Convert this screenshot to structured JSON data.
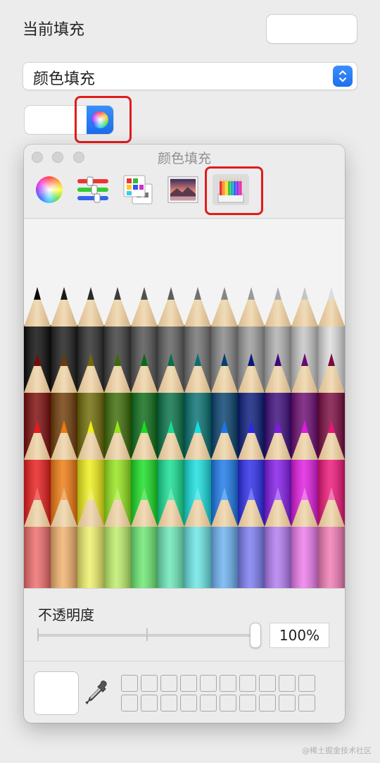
{
  "inspector": {
    "current_fill_label": "当前填充",
    "fill_type_value": "颜色填充"
  },
  "color_panel": {
    "title": "颜色填充",
    "toolbar_tabs": [
      {
        "icon": "color-wheel-icon"
      },
      {
        "icon": "color-sliders-icon"
      },
      {
        "icon": "color-palettes-icon"
      },
      {
        "icon": "image-palettes-icon"
      },
      {
        "icon": "pencils-icon",
        "selected": true
      }
    ],
    "pencils": {
      "rows": [
        [
          "#0a0a0a",
          "#1a1a1a",
          "#2a2a2a",
          "#3c3c3c",
          "#505050",
          "#5e5e5e",
          "#707070",
          "#858585",
          "#9a9a9a",
          "#aeaeae",
          "#c4c4c4",
          "#dcdcdc"
        ],
        [
          "#7b0a0a",
          "#6e3a06",
          "#6e6a06",
          "#3c6a06",
          "#0a6a16",
          "#067046",
          "#067070",
          "#06406e",
          "#0a1a7a",
          "#3a0a7a",
          "#6a0a70",
          "#7a0a40"
        ],
        [
          "#e81b1b",
          "#ee7a10",
          "#eeee18",
          "#94e41a",
          "#18dc22",
          "#14dc90",
          "#18dede",
          "#1a78e8",
          "#2a2ae8",
          "#8218e8",
          "#e01ae0",
          "#ec1478"
        ],
        [
          "#ee6a6a",
          "#f0b06a",
          "#eef06a",
          "#bcee6a",
          "#6ae670",
          "#6ae6b8",
          "#6ae6e6",
          "#6ab0f0",
          "#7a7af0",
          "#b07af0",
          "#ec7aec",
          "#f07ab4"
        ]
      ]
    },
    "opacity_label": "不透明度",
    "opacity_value": "100%",
    "opacity_level": 1.0,
    "current_color": "#ffffff",
    "swatch_slots": 20
  },
  "accent_color": "#1e6fee",
  "highlight_color": "#e21c1c",
  "watermark": "@稀土掘金技术社区"
}
